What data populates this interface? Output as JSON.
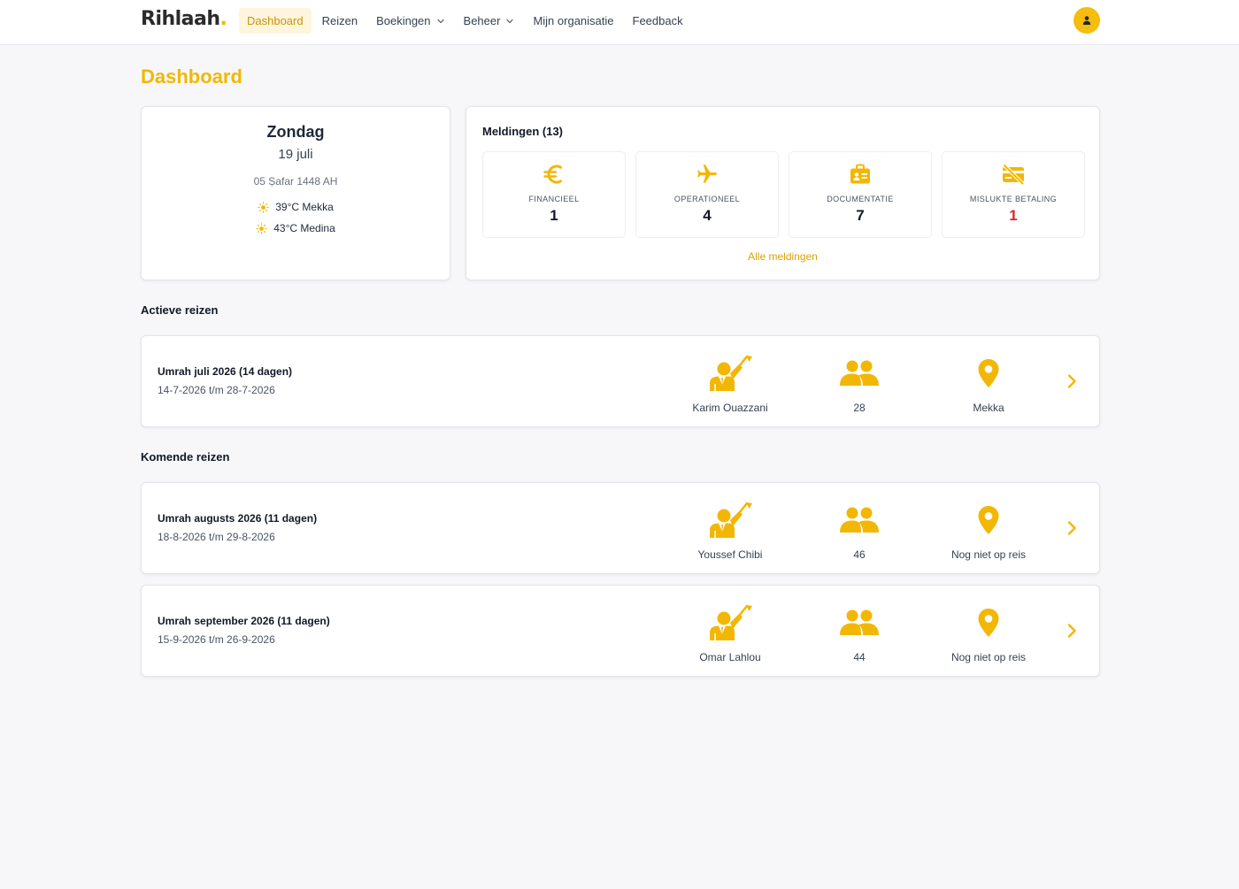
{
  "colors": {
    "accent": "#f2b705",
    "danger": "#dc2626"
  },
  "brand": {
    "name": "Rihlaah",
    "dot": "."
  },
  "nav": [
    {
      "label": "Dashboard",
      "active": true
    },
    {
      "label": "Reizen"
    },
    {
      "label": "Boekingen",
      "dropdown": true
    },
    {
      "label": "Beheer",
      "dropdown": true
    },
    {
      "label": "Mijn organisatie"
    },
    {
      "label": "Feedback"
    }
  ],
  "user_icon": "user-icon",
  "page_title": "Dashboard",
  "today": {
    "day": "Zondag",
    "date": "19 juli",
    "hijri": "05 Ṣafar 1448 AH",
    "weather": [
      {
        "icon": "sun-icon",
        "text": "39°C Mekka"
      },
      {
        "icon": "sun-icon",
        "text": "43°C Medina"
      }
    ]
  },
  "notifications": {
    "title": "Meldingen (13)",
    "items": [
      {
        "icon": "euro-icon",
        "label": "FINANCIEEL",
        "count": "1"
      },
      {
        "icon": "airplane-icon",
        "label": "OPERATIONEEL",
        "count": "4"
      },
      {
        "icon": "id-badge-icon",
        "label": "DOCUMENTATIE",
        "count": "7"
      },
      {
        "icon": "card-off-icon",
        "label": "MISLUKTE BETALING",
        "count": "1",
        "alert": true
      }
    ],
    "all_link": "Alle meldingen"
  },
  "active_title": "Actieve reizen",
  "upcoming_title": "Komende reizen",
  "active_trips": [
    {
      "name": "Umrah juli 2026 (14 dagen)",
      "dates": "14-7-2026 t/m 28-7-2026",
      "guide": "Karim Ouazzani",
      "people": "28",
      "location": "Mekka"
    }
  ],
  "upcoming_trips": [
    {
      "name": "Umrah augusts 2026 (11 dagen)",
      "dates": "18-8-2026 t/m 29-8-2026",
      "guide": "Youssef Chibi",
      "people": "46",
      "location": "Nog niet op reis"
    },
    {
      "name": "Umrah september 2026 (11 dagen)",
      "dates": "15-9-2026 t/m 26-9-2026",
      "guide": "Omar Lahlou",
      "people": "44",
      "location": "Nog niet op reis"
    }
  ]
}
